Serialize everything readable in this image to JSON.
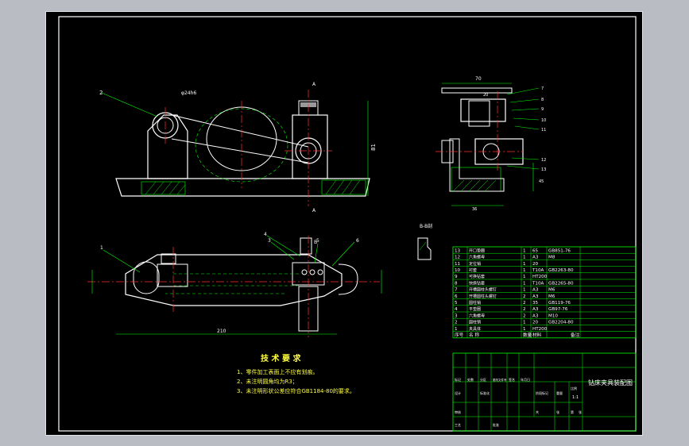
{
  "notes": {
    "title": "技 术 要 求",
    "items": [
      "1、零件加工表面上不应有划痕。",
      "2、未注明圆角均为R3；",
      "3、未注明形状公差应符合GB1184-80的要求。"
    ]
  },
  "section_label": "B-B剖",
  "dims": {
    "overall_length": "210",
    "height": "81",
    "top_width": "70",
    "inner": "20",
    "base": "36",
    "side": "45",
    "hole": "φ24h6"
  },
  "balloons": {
    "top_view": [
      "2"
    ],
    "front": [
      "1",
      "4",
      "3",
      "5",
      "6"
    ],
    "side": [
      "7",
      "8",
      "9",
      "10",
      "11",
      "12",
      "13"
    ],
    "section_marks": [
      "A",
      "A",
      "B"
    ]
  },
  "bom": {
    "rows": [
      {
        "no": "13",
        "name": "开口垫圈",
        "qty": "1",
        "mat": "65",
        "std": "GB851-76"
      },
      {
        "no": "12",
        "name": "六角螺母",
        "qty": "1",
        "mat": "A3",
        "std": "M8"
      },
      {
        "no": "11",
        "name": "定位销",
        "qty": "1",
        "mat": "20",
        "std": ""
      },
      {
        "no": "10",
        "name": "衬套",
        "qty": "1",
        "mat": "T10A",
        "std": "GB2263-80"
      },
      {
        "no": "9",
        "name": "可换钻套",
        "qty": "1",
        "mat": "HT200",
        "std": ""
      },
      {
        "no": "8",
        "name": "快换钻套",
        "qty": "1",
        "mat": "T10A",
        "std": "GB2265-80"
      },
      {
        "no": "7",
        "name": "开槽圆柱头螺钉",
        "qty": "1",
        "mat": "A3",
        "std": "M6"
      },
      {
        "no": "6",
        "name": "开槽圆柱头螺钉",
        "qty": "2",
        "mat": "A3",
        "std": "M6"
      },
      {
        "no": "5",
        "name": "圆柱销",
        "qty": "2",
        "mat": "35",
        "std": "GB119-76"
      },
      {
        "no": "4",
        "name": "平垫圈",
        "qty": "2",
        "mat": "A3",
        "std": "GB97-76"
      },
      {
        "no": "3",
        "name": "六角螺母",
        "qty": "2",
        "mat": "A3",
        "std": "M10"
      },
      {
        "no": "2",
        "name": "圆柱销",
        "qty": "1",
        "mat": "20",
        "std": "GB2204-80"
      },
      {
        "no": "1",
        "name": "夹具体",
        "qty": "1",
        "mat": "HT200",
        "std": ""
      }
    ],
    "header": {
      "no": "序号",
      "name": "名 称",
      "qty": "数量",
      "mat": "材料",
      "note": "备注"
    }
  },
  "title_block": {
    "drawing_title": "钻床夹具装配图",
    "cells": [
      "标记",
      "处数",
      "分区",
      "更改文件号",
      "签名",
      "年月日",
      "设计",
      "标准化",
      "阶段标记",
      "重量",
      "比例",
      "审核",
      "工艺",
      "批准",
      "共",
      "张",
      "第",
      "张"
    ],
    "scale": "1:1"
  },
  "colors": {
    "sheet": "#000000",
    "frame": "#ffffff",
    "outline": "#ffffff",
    "hidden": "#00ff00",
    "centerline": "#ff3030",
    "dimension": "#00ff00",
    "hatch": "#00ff00",
    "text": "#ffff40",
    "table": "#00ff00"
  }
}
